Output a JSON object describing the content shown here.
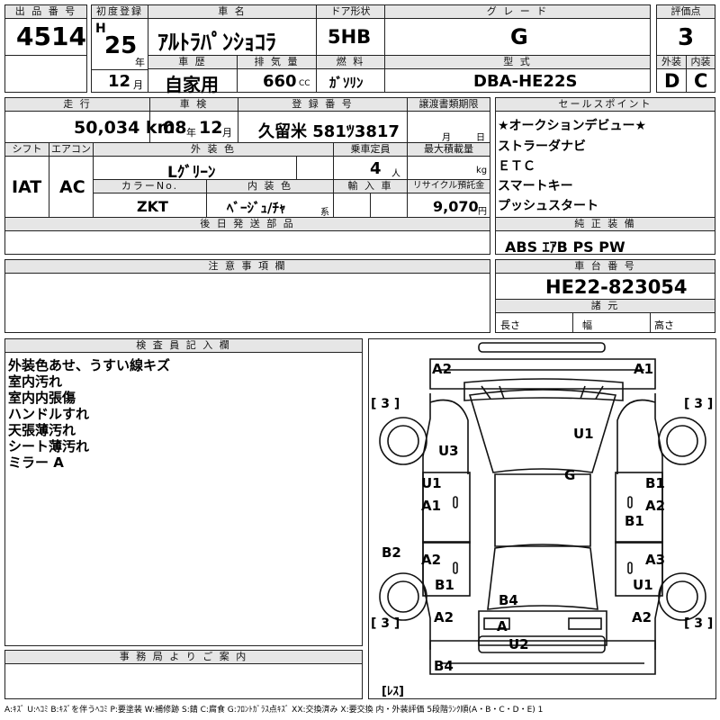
{
  "header_labels": {
    "lot_no": "出 品 番 号",
    "first_reg": "初度登録",
    "car_name": "車 名",
    "door": "ドア形状",
    "grade": "グ レ ー ド",
    "score": "評価点",
    "history": "車 歴",
    "displacement": "排 気 量",
    "fuel": "燃 料",
    "model": "型 式",
    "exterior": "外装",
    "interior": "内装",
    "mileage": "走 行",
    "inspection": "車 検",
    "registration": "登 録 番 号",
    "transfer_deadline": "譲渡書類期限",
    "sales_points": "セールスポイント",
    "shift": "シフト",
    "aircon": "エアコン",
    "ext_color": "外 装 色",
    "capacity": "乗車定員",
    "max_load": "最大積載量",
    "color_no": "カラーNo.",
    "int_color": "内 装 色",
    "import": "輸 入 車",
    "recycle": "リサイクル預託金",
    "later_parts": "後 日 発 送 部 品",
    "genuine": "純 正 装 備",
    "notes": "注 意 事 項 欄",
    "chassis": "車 台 番 号",
    "specs": "諸 元",
    "inspector": "検 査 員 記 入 欄",
    "office": "事 務 局 よ り ご 案 内"
  },
  "lot_no": "4514",
  "era_letter": "H",
  "year_value": "25",
  "year_unit": "年",
  "month_value": "12",
  "month_unit": "月",
  "car_name": "ｱﾙﾄﾗﾊﾟﾝｼｮｺﾗ",
  "door_type": "5HB",
  "grade": "G",
  "score": "3",
  "history": "自家用",
  "displacement": "660",
  "displacement_unit": "CC",
  "fuel": "ｶﾞｿﾘﾝ",
  "model": "DBA-HE22S",
  "exterior_grade": "D",
  "interior_grade": "C",
  "mileage": "50,034 km",
  "inspection_year": "08",
  "inspection_year_unit": "年",
  "inspection_month": "12",
  "inspection_month_unit": "月",
  "registration": "久留米 581ﾂ3817",
  "transfer_month_unit": "月",
  "transfer_day_unit": "日",
  "sales_points": [
    "★オークションデビュー★",
    "ストラーダナビ",
    "ＥＴＣ",
    "スマートキー",
    "プッシュスタート"
  ],
  "shift": "IAT",
  "aircon": "AC",
  "ext_color": "Lｸﾞﾘｰﾝ",
  "capacity": "4",
  "capacity_unit": "人",
  "max_load_unit": "kg",
  "color_no": "ZKT",
  "int_color": "ﾍﾞｰｼﾞｭ/ﾁｬ",
  "int_color_suffix": "系",
  "recycle": "9,070",
  "recycle_unit": "円",
  "genuine": "ABS ｴｱB PS PW",
  "chassis_no": "HE22-823054",
  "spec_labels": {
    "length": "長さ",
    "width": "幅",
    "height": "高さ"
  },
  "inspector_notes": [
    "外装色あせ、うすい線キズ",
    "室内汚れ",
    "室内内張傷",
    "ハンドルすれ",
    "天張薄汚れ",
    "シート薄汚れ",
    "ミラー A"
  ],
  "diagram_marks": {
    "a2_tl": "A2",
    "a1_tr": "A1",
    "seal_fl": "[ 3 ]",
    "seal_fr": "[ 3 ]",
    "u1_roof": "U1",
    "u3_hood": "U3",
    "g_glass": "G",
    "u1_l": "U1",
    "a1_l": "A1",
    "b1_r": "B1",
    "a2_r": "A2",
    "b1_r2": "B1",
    "b2_l": "B2",
    "a2_l2": "A2",
    "a3_r": "A3",
    "b1_l": "B1",
    "u1_r": "U1",
    "b4_mid": "B4",
    "seal_rl": "[ 3 ]",
    "seal_rr": "[ 3 ]",
    "a2_l3": "A2",
    "a2_r3": "A2",
    "a_rear": "A",
    "u2_rear": "U2",
    "b4_rear": "B4",
    "res": "[ﾚｽ]"
  },
  "legend": "A:ｷｽﾞ U:ﾍｺﾐ B:ｷｽﾞを伴うﾍｺﾐ P:要塗装 W:補修跡 S:錆 C:腐食 G:ﾌﾛﾝﾄｶﾞﾗｽ点ｷｽﾞ XX:交換済み X:要交換  内・外装評価 5段階ﾗﾝｸ順(A・B・C・D・E) 1",
  "colors": {
    "header_bg": "#e6e6e6",
    "line": "#222222"
  }
}
